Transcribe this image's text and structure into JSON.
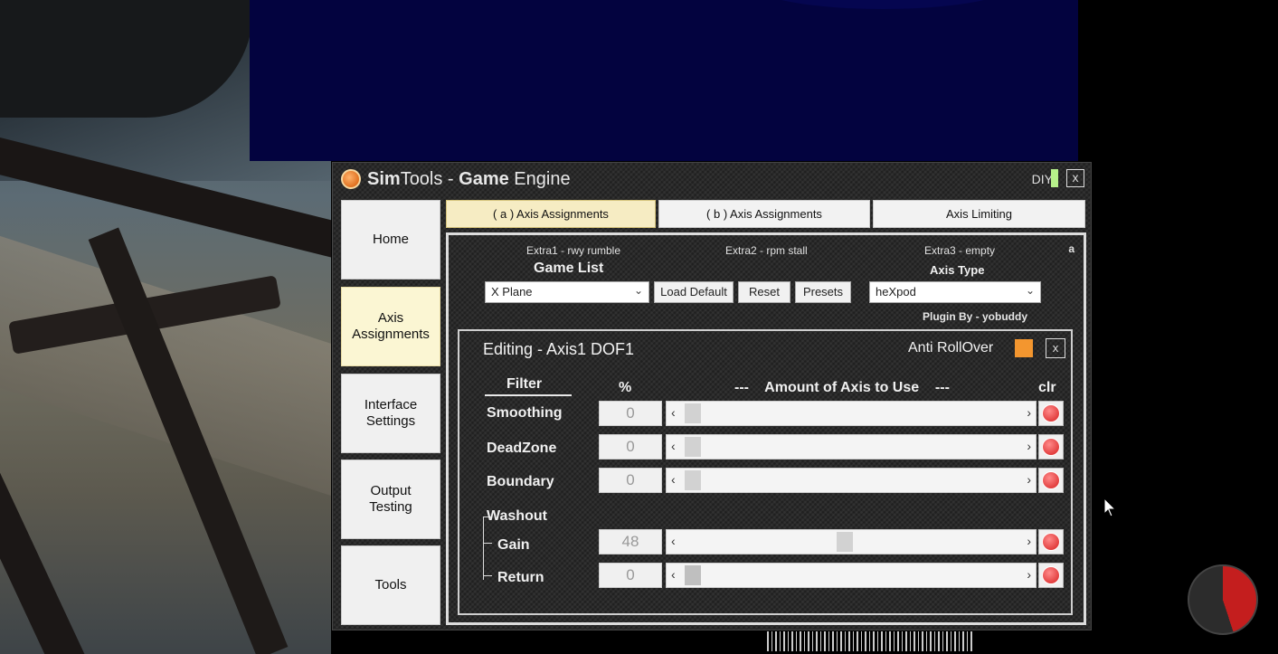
{
  "app": {
    "title_part1": "Sim",
    "title_part2": "Tools - ",
    "title_part3": "Game",
    "title_part4": " Engine",
    "diy_label": "DIY",
    "close_label": "x",
    "indicator_color": "#b6f08a"
  },
  "nav": [
    {
      "label": "Home"
    },
    {
      "label": "Axis Assignments"
    },
    {
      "label": "Interface Settings"
    },
    {
      "label": "Output Testing"
    },
    {
      "label": "Tools"
    }
  ],
  "tabs": [
    {
      "label": "( a ) Axis Assignments"
    },
    {
      "label": "( b ) Axis Assignments"
    },
    {
      "label": "Axis Limiting"
    }
  ],
  "content": {
    "extra1": "Extra1 - rwy rumble",
    "extra2": "Extra2 - rpm  stall",
    "extra3": "Extra3 - empty",
    "corner_label": "a",
    "game_list_label": "Game List",
    "game_selected": "X Plane",
    "load_default": "Load Default",
    "reset": "Reset",
    "presets": "Presets",
    "axis_type_label": "Axis Type",
    "axis_type_selected": "heXpod",
    "plugin_by": "Plugin By - yobuddy"
  },
  "editor": {
    "title": "Editing - Axis1 DOF1",
    "anti_rollover": "Anti RollOver",
    "anti_rollover_color": "#f3962f",
    "close_label": "x",
    "headers": {
      "filter": "Filter",
      "percent": "%",
      "amount": "---    Amount of Axis to Use    ---",
      "clr": "clr"
    },
    "washout_label": "Washout",
    "rows": [
      {
        "label": "Smoothing",
        "value": "0",
        "level": 0
      },
      {
        "label": "DeadZone",
        "value": "0",
        "level": 0
      },
      {
        "label": "Boundary",
        "value": "0",
        "level": 0
      },
      {
        "label": "Gain",
        "value": "48",
        "level": 48
      },
      {
        "label": "Return",
        "value": "0",
        "level": 0
      }
    ]
  }
}
